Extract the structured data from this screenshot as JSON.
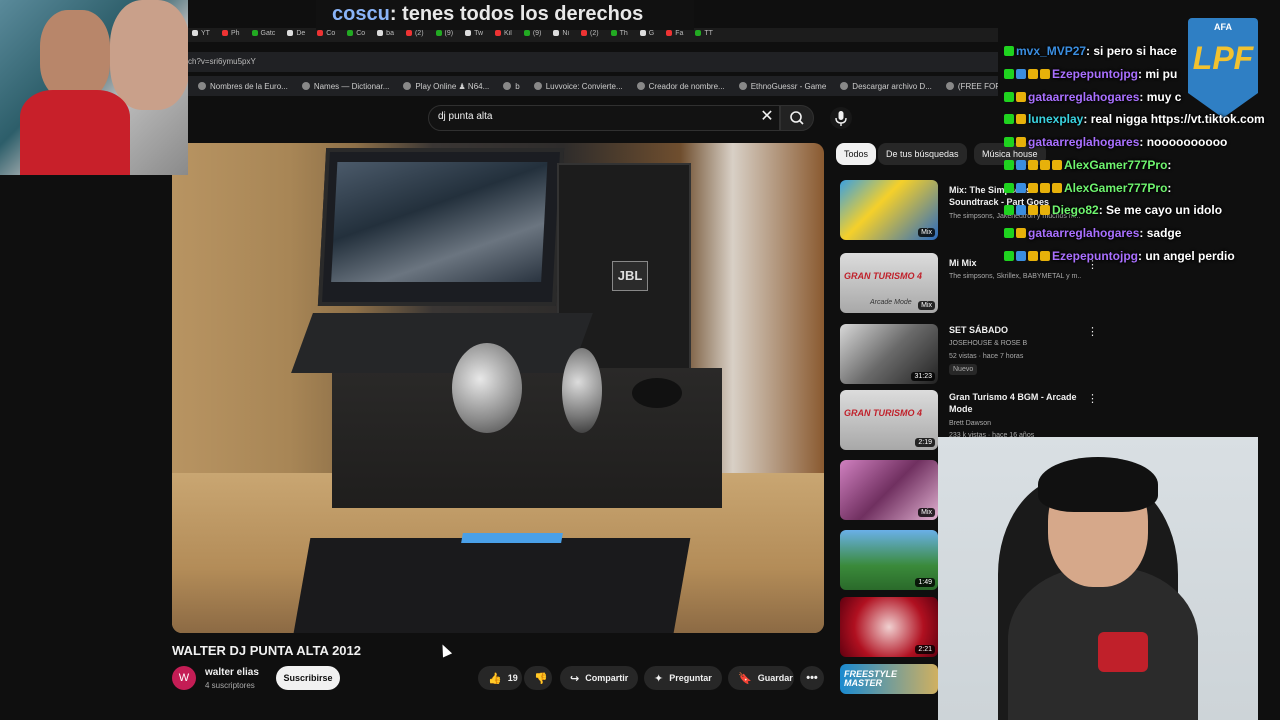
{
  "caption": {
    "name": "coscu",
    "text": ": tenes todos los derechos"
  },
  "browser": {
    "url": "ch?v=sri6ymu5pxY",
    "tabs": [
      "YT",
      "Ph",
      "Gatc",
      "De",
      "Co",
      "Co",
      "ba",
      "(2)",
      "(9)",
      "Tw",
      "Kil",
      "(9)",
      "Ni",
      "(2)",
      "Th",
      "G",
      "Fa",
      "TT"
    ],
    "bookmarks": [
      "Nombres de la Euro...",
      "Names — Dictionar...",
      "Play Online ♟ N64...",
      "b",
      "Luvvoice: Convierte...",
      "Creador de nombre...",
      "EthnoGuessr - Game",
      "Descargar archivo D...",
      "(FREE FOR PROFIT)..."
    ]
  },
  "search": {
    "query": "dj punta alta",
    "clear_icon": "close-icon",
    "search_icon": "search-icon",
    "mic_icon": "mic-icon"
  },
  "video": {
    "speaker_brand": "JBL",
    "title": "WALTER DJ PUNTA ALTA 2012",
    "channel": "walter elias",
    "channel_initial": "W",
    "subscribers": "4 suscriptores",
    "subscribe_label": "Suscribirse",
    "likes": "19",
    "share_label": "Compartir",
    "ask_label": "Preguntar",
    "save_label": "Guardar"
  },
  "chips": [
    "Todos",
    "De tus búsquedas",
    "Música house"
  ],
  "recommendations": [
    {
      "title": "Mix: The Simpsons Soundtrack - Part Goes",
      "subtitle": "The simpsons, Jakeneutron y muchos m...",
      "badge": "Mix"
    },
    {
      "title": "Mi Mix",
      "subtitle": "The simpsons, Skrillex, BABYMETAL y m...",
      "badge": "Mix"
    },
    {
      "title": "SET SÁBADO",
      "subtitle": "JOSEHOUSE & ROSE B",
      "meta": "52 vistas · hace 7 horas",
      "tag": "Nuevo",
      "badge": "31:23"
    },
    {
      "title": "Gran Turismo 4 BGM - Arcade Mode",
      "subtitle": "Brett Dawson",
      "meta": "233 k vistas · hace 16 años",
      "badge": "2:19"
    },
    {
      "badge": "Mix"
    },
    {
      "badge": "1:49"
    },
    {
      "badge": "2:21"
    },
    {
      "badge": ""
    }
  ],
  "thumb_texts": {
    "gt4": "GRAN TURISMO 4",
    "arcade": "Arcade Mode",
    "freestyle": "FREESTYLE MASTER"
  },
  "chat": [
    {
      "user": "mvx_MVP27",
      "color": "#3b8ee0",
      "text": ": si pero si hace",
      "icons": [
        "g"
      ]
    },
    {
      "user": "Ezepepuntojpg",
      "color": "#a970ff",
      "text": ": mi pu",
      "icons": [
        "g",
        "b",
        "y",
        "y"
      ]
    },
    {
      "user": "gataarreglahogares",
      "color": "#a970ff",
      "text": ": muy c",
      "icons": [
        "g",
        "y"
      ]
    },
    {
      "user": "lunexplay",
      "color": "#3bd3e0",
      "text": ": real nigga https://vt.tiktok.com",
      "icons": [
        "g",
        "y"
      ]
    },
    {
      "user": "gataarreglahogares",
      "color": "#a970ff",
      "text": ": noooooooooo",
      "icons": [
        "g",
        "y"
      ]
    },
    {
      "user": "AlexGamer777Pro",
      "color": "#6ff56f",
      "text": ":",
      "icons": [
        "g",
        "b",
        "y",
        "y",
        "y"
      ]
    },
    {
      "user": "AlexGamer777Pro",
      "color": "#6ff56f",
      "text": ":",
      "icons": [
        "g",
        "b",
        "y",
        "y",
        "y"
      ]
    },
    {
      "user": "Diego82",
      "color": "#6ff56f",
      "text": ": Se me cayo un idolo",
      "icons": [
        "g",
        "b",
        "y",
        "y"
      ]
    },
    {
      "user": "gataarreglahogares",
      "color": "#a970ff",
      "text": ": sadge",
      "icons": [
        "g",
        "y"
      ]
    },
    {
      "user": "Ezepepuntojpg",
      "color": "#a970ff",
      "text": ": un angel perdio",
      "icons": [
        "g",
        "b",
        "y",
        "y"
      ]
    }
  ],
  "badge": {
    "top": "AFA",
    "logo": "LPF"
  },
  "colors": {
    "background": "#0f0f0f",
    "accent_red": "#c41d55",
    "chat_green": "#1fd31f"
  }
}
